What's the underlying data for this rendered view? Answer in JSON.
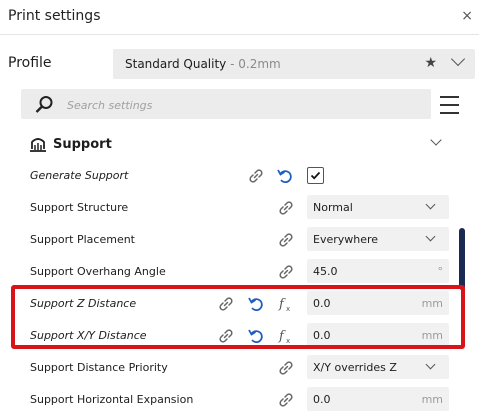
{
  "window": {
    "title": "Print settings",
    "close_glyph": "×"
  },
  "profile": {
    "label": "Profile",
    "name": "Standard Quality",
    "separator": " - ",
    "layer": "0.2mm",
    "favorite_icon": "star-icon"
  },
  "search": {
    "placeholder": "Search settings"
  },
  "category": {
    "label": "Support",
    "icon": "support-icon"
  },
  "settings": [
    {
      "label": "Generate Support",
      "control": "checkbox",
      "checked": true
    },
    {
      "label": "Support Structure",
      "value": "Normal"
    },
    {
      "label": "Support Placement",
      "value": "Everywhere"
    },
    {
      "label": "Support Overhang Angle",
      "value": "45.0",
      "unit": "°"
    },
    {
      "label": "Support Z Distance",
      "value": "0.0",
      "unit": "mm"
    },
    {
      "label": "Support X/Y Distance",
      "value": "0.0",
      "unit": "mm"
    },
    {
      "label": "Support Distance Priority",
      "value": "X/Y overrides Z"
    },
    {
      "label": "Support Horizontal Expansion",
      "value": "0.0",
      "unit": "mm"
    }
  ],
  "colors": {
    "highlight": "#d7141a",
    "reset_icon": "#1f5fbf",
    "scrollbar": "#1b2a52"
  }
}
